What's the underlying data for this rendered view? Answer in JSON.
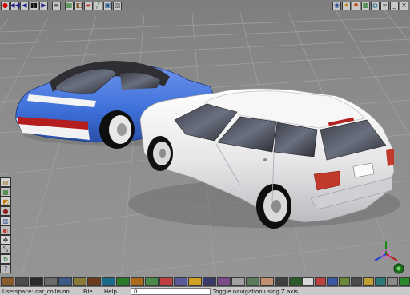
{
  "top_toolbar": {
    "left_buttons": [
      {
        "name": "record-button",
        "glyph": "●",
        "color": "#d00000"
      },
      {
        "name": "rewind-button",
        "glyph": "◀◀",
        "color": "#1a1a8a"
      },
      {
        "name": "prev-frame-button",
        "glyph": "◀",
        "color": "#1a1a8a"
      },
      {
        "name": "stop-button",
        "glyph": "▮▮",
        "color": "#111111"
      },
      {
        "name": "next-frame-button",
        "glyph": "▶",
        "color": "#1a1a8a"
      },
      {
        "name": "timeline-button",
        "glyph": "≡",
        "color": "#333333"
      },
      {
        "name": "color-button",
        "glyph": "▦",
        "color": "#2b7a2b"
      },
      {
        "name": "material-button",
        "glyph": "◧",
        "color": "#7a4b1a"
      },
      {
        "name": "paint-button",
        "glyph": "▰",
        "color": "#c0392b"
      },
      {
        "name": "brush-button",
        "glyph": "╱",
        "color": "#2a6f2a"
      },
      {
        "name": "render-button",
        "glyph": "▣",
        "color": "#1a4f8a"
      },
      {
        "name": "texture-button",
        "glyph": "▧",
        "color": "#555555"
      }
    ],
    "right_buttons": [
      {
        "name": "camera-button",
        "glyph": "◉",
        "color": "#2a4f8a"
      },
      {
        "name": "light-button",
        "glyph": "✦",
        "color": "#c07a00"
      },
      {
        "name": "flame-button",
        "glyph": "✸",
        "color": "#d04000"
      },
      {
        "name": "image-button",
        "glyph": "▩",
        "color": "#2a7a2a"
      },
      {
        "name": "globe-button",
        "glyph": "◍",
        "color": "#1a6f8a"
      },
      {
        "name": "chain-button",
        "glyph": "∞",
        "color": "#333333"
      },
      {
        "name": "minimize-button",
        "glyph": "_",
        "color": "#111111"
      },
      {
        "name": "close-button",
        "glyph": "×",
        "color": "#111111"
      }
    ]
  },
  "left_toolbar": [
    {
      "name": "layer-tool",
      "glyph": "▤",
      "color": "#a08040"
    },
    {
      "name": "swatch-tool",
      "glyph": "▦",
      "color": "#2a7a2a"
    },
    {
      "name": "select-tool",
      "glyph": "◩",
      "color": "#c07a00"
    },
    {
      "name": "sphere-tool",
      "glyph": "●",
      "color": "#8a1a1a"
    },
    {
      "name": "paint-tool",
      "glyph": "▥",
      "color": "#2a4f8a"
    },
    {
      "name": "palette-tool",
      "glyph": "◐",
      "color": "#c0392b"
    },
    {
      "name": "move-tool",
      "glyph": "✥",
      "color": "#333333"
    },
    {
      "name": "scale-tool",
      "glyph": "⤡",
      "color": "#333333"
    },
    {
      "name": "rotate-tool",
      "glyph": "↻",
      "color": "#1a6f2a"
    },
    {
      "name": "help-tool",
      "glyph": "?",
      "color": "#1a1a8a"
    }
  ],
  "bottom_toolbar": {
    "left_icons": [
      "object-icon",
      "mesh-icon",
      "film-icon",
      "gear-icon",
      "wrench-icon",
      "cube-icon",
      "brick-icon",
      "sphere-icon",
      "tree-icon",
      "cone-icon",
      "link-icon",
      "paint-icon",
      "grid-icon",
      "light-icon",
      "camera-icon",
      "chart-icon",
      "bone-icon",
      "spline-icon",
      "face-icon",
      "figure-icon",
      "animation-icon"
    ],
    "right_icons": [
      "pointer-icon",
      "target-icon",
      "grid-icon",
      "picture-icon",
      "rotate-icon",
      "zoom-icon",
      "world-icon",
      "pan-icon",
      "axis-icon"
    ]
  },
  "status_bar": {
    "workspace": "Userspace: car_collision",
    "menu_file": "File",
    "menu_help": "Help",
    "frame_field": "0",
    "hint": "Toggle navigation using Z axis"
  },
  "scene": {
    "porsche_color": "#3d6fd8",
    "golf_color": "#e9e9ea",
    "grid_color": "#9c9c9c",
    "background_color": "#8a8a8a"
  }
}
